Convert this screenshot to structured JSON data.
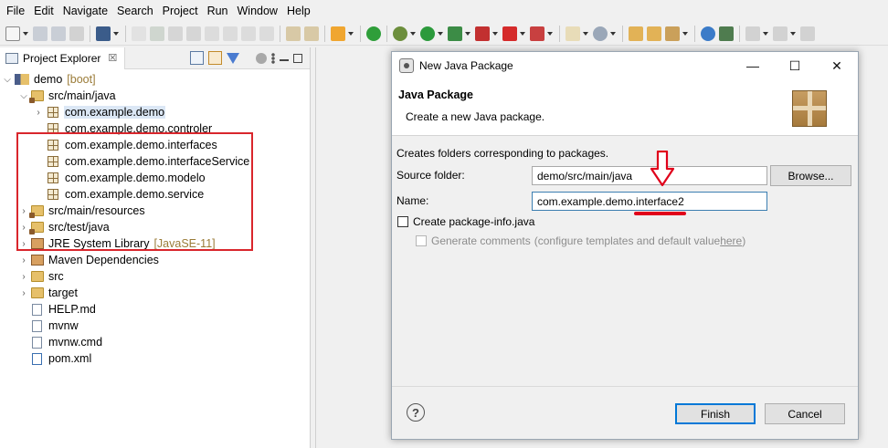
{
  "menubar": [
    "File",
    "Edit",
    "Navigate",
    "Search",
    "Project",
    "Run",
    "Window",
    "Help"
  ],
  "explorer": {
    "tab_label": "Project Explorer",
    "close_glyph": "☒",
    "project": {
      "name": "demo",
      "decoration": "[boot]"
    },
    "tree": [
      {
        "label": "src/main/java",
        "type": "src-folder",
        "expanded": true
      },
      {
        "label": "com.example.demo",
        "type": "package",
        "selected": true,
        "collapsible": true
      },
      {
        "label": "com.example.demo.controler",
        "type": "package"
      },
      {
        "label": "com.example.demo.interfaces",
        "type": "package"
      },
      {
        "label": "com.example.demo.interfaceService",
        "type": "package"
      },
      {
        "label": "com.example.demo.modelo",
        "type": "package"
      },
      {
        "label": "com.example.demo.service",
        "type": "package"
      },
      {
        "label": "src/main/resources",
        "type": "src-folder"
      },
      {
        "label": "src/test/java",
        "type": "src-folder"
      },
      {
        "label": "JRE System Library",
        "decoration": "[JavaSE-11]",
        "type": "library"
      },
      {
        "label": "Maven Dependencies",
        "type": "library"
      },
      {
        "label": "src",
        "type": "folder"
      },
      {
        "label": "target",
        "type": "folder"
      },
      {
        "label": "HELP.md",
        "type": "file"
      },
      {
        "label": "mvnw",
        "type": "file"
      },
      {
        "label": "mvnw.cmd",
        "type": "file"
      },
      {
        "label": "pom.xml",
        "type": "file"
      }
    ]
  },
  "dialog": {
    "title": "New Java Package",
    "banner_title": "Java Package",
    "banner_desc": "Create a new Java package.",
    "body_desc": "Creates folders corresponding to packages.",
    "source_folder_label": "Source folder:",
    "source_folder_value": "demo/src/main/java",
    "browse_label": "Browse...",
    "name_label": "Name:",
    "name_value": "com.example.demo.interface2",
    "create_info_label": "Create package-info.java",
    "generate_comments_label": "Generate comments",
    "configure_prefix": "(configure templates and default value ",
    "configure_link": "here",
    "configure_suffix": ")",
    "help_glyph": "?",
    "finish_label": "Finish",
    "cancel_label": "Cancel"
  },
  "colors": {
    "annotation_red": "#d9262c",
    "selection": "#dbe7f5",
    "focus_border": "#3c7fb1",
    "default_button_border": "#0078d7"
  }
}
